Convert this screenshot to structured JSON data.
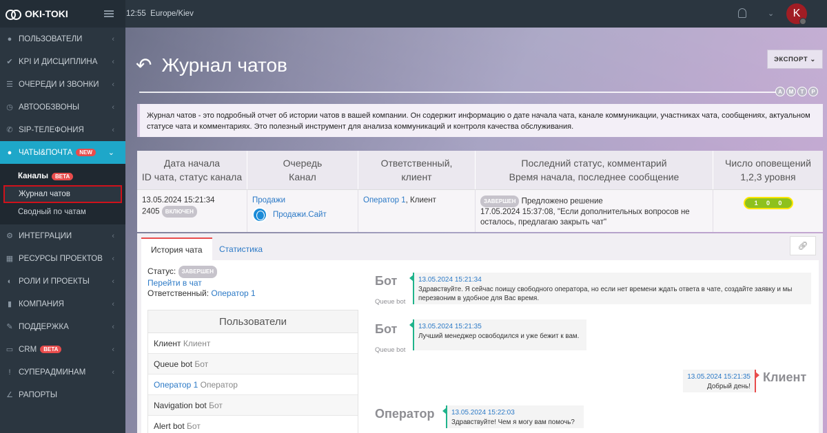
{
  "app": {
    "brand": "OKI-TOKI",
    "time": "12:55",
    "timezone": "Europe/Kiev",
    "avatar_letter": "K"
  },
  "sidebar": {
    "items": [
      {
        "label": "ПОЛЬЗОВАТЕЛИ",
        "icon": "user-icon"
      },
      {
        "label": "KPI И ДИСЦИПЛИНА",
        "icon": "check-icon"
      },
      {
        "label": "ОЧЕРЕДИ И ЗВОНКИ",
        "icon": "list-icon"
      },
      {
        "label": "АВТООБЗВОНЫ",
        "icon": "clock-icon"
      },
      {
        "label": "SIP-ТЕЛЕФОНИЯ",
        "icon": "phone-icon"
      },
      {
        "label": "ЧАТЫ&ПОЧТА",
        "icon": "chat-icon",
        "badge": "NEW"
      },
      {
        "label": "ИНТЕГРАЦИИ",
        "icon": "gears-icon"
      },
      {
        "label": "РЕСУРСЫ ПРОЕКТОВ",
        "icon": "grid-icon"
      },
      {
        "label": "РОЛИ И ПРОЕКТЫ",
        "icon": "toggle-icon"
      },
      {
        "label": "КОМПАНИЯ",
        "icon": "bar-chart-icon"
      },
      {
        "label": "ПОДДЕРЖКА",
        "icon": "wrench-icon"
      },
      {
        "label": "CRM",
        "icon": "card-icon",
        "badge": "BETA"
      },
      {
        "label": "СУПЕРАДМИНАМ",
        "icon": "exclamation-icon"
      },
      {
        "label": "РАПОРТЫ",
        "icon": "line-chart-icon"
      }
    ],
    "sub": {
      "channels": "Каналы",
      "channels_badge": "BETA",
      "chat_log": "Журнал чатов",
      "summary": "Сводный по чатам"
    }
  },
  "header": {
    "title": "Журнал чатов",
    "export": "ЭКСПОРТ",
    "amtp": [
      "A",
      "M",
      "T",
      "P"
    ]
  },
  "description": "Журнал чатов - это подробный отчет об истории чатов в вашей компании. Он содержит информацию о дате начала чата, канале коммуникации, участниках чата, сообщениях, актуальном статусе чата и комментариях. Это полезный инструмент для анализа коммуникаций и контроля качества обслуживания.",
  "table": {
    "headers": [
      [
        "Дата начала",
        "ID чата, статус канала"
      ],
      [
        "Очередь",
        "Канал"
      ],
      [
        "Ответственный,",
        "клиент"
      ],
      [
        "Последний статус, комментарий",
        "Время начала, последнее сообщение"
      ],
      [
        "Число оповещений",
        "1,2,3 уровня"
      ]
    ],
    "row": {
      "date": "13.05.2024 15:21:34",
      "id": "2405",
      "channel_status": "ВКЛЮЧЕН",
      "queue": "Продажи",
      "channel": "Продажи.Сайт",
      "operator": "Оператор 1",
      "client": ", Клиент",
      "status_badge": "ЗАВЕРШЕН",
      "status_comment": "Предложено решение",
      "last_msg": "17.05.2024 15:37:08, \"Если дополнительных вопросов не осталось, предлагаю закрыть чат\"",
      "notif": [
        "1",
        "0",
        "0"
      ]
    }
  },
  "tabs": {
    "history": "История чата",
    "stats": "Статистика"
  },
  "chat_info": {
    "status_label": "Статус:",
    "status_badge": "ЗАВЕРШЕН",
    "goto": "Перейти в чат",
    "responsible_label": "Ответственный:",
    "responsible": "Оператор 1"
  },
  "users": {
    "title": "Пользователи",
    "rows": [
      {
        "name": "Клиент",
        "role": "Клиент"
      },
      {
        "name": "Queue bot",
        "role": "Бот"
      },
      {
        "name": "Оператор 1",
        "role": "Оператор"
      },
      {
        "name": "Navigation bot",
        "role": "Бот"
      },
      {
        "name": "Alert bot",
        "role": "Бот"
      }
    ]
  },
  "messages": [
    {
      "sender": "Бот",
      "sub": "Queue bot",
      "ts": "13.05.2024 15:21:34",
      "text": "Здравствуйте. Я сейчас поищу свободного оператора, но если нет времени ждать ответа в чате, создайте заявку и мы перезвоним в удобное для Вас время."
    },
    {
      "sender": "Бот",
      "sub": "Queue bot",
      "ts": "13.05.2024 15:21:35",
      "text": "Лучший менеджер освободился и уже бежит к вам."
    },
    {
      "sender": "Клиент",
      "sub": "",
      "ts": "13.05.2024 15:21:35",
      "text": "Добрый день!"
    },
    {
      "sender": "Оператор",
      "sub": "",
      "ts": "13.05.2024 15:22:03",
      "text": "Здравствуйте! Чем я могу вам помочь?"
    }
  ]
}
